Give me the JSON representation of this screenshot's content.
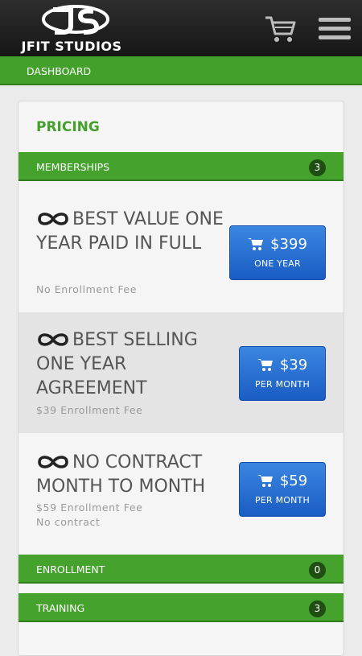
{
  "brand": {
    "name": "JFIT STUDIOS"
  },
  "header": {
    "cart_icon": "cart-icon",
    "menu_icon": "hamburger-menu-icon"
  },
  "breadcrumb": {
    "label": "DASHBOARD"
  },
  "pricing": {
    "title": "PRICING",
    "sections": [
      {
        "label": "MEMBERSHIPS",
        "count": "3"
      },
      {
        "label": "ENROLLMENT",
        "count": "0"
      },
      {
        "label": "TRAINING",
        "count": "3"
      }
    ],
    "plans": [
      {
        "name": "BEST VALUE ONE YEAR PAID IN FULL",
        "notes": [
          "No Enrollment Fee"
        ],
        "price": "$399",
        "period": "ONE YEAR"
      },
      {
        "name": "BEST SELLING ONE YEAR AGREEMENT",
        "notes": [
          "$39 Enrollment Fee"
        ],
        "price": "$39",
        "period": "PER MONTH"
      },
      {
        "name": "NO CONTRACT MONTH TO MONTH",
        "notes": [
          "$59 Enrollment Fee",
          "No contract"
        ],
        "price": "$59",
        "period": "PER MONTH"
      }
    ]
  },
  "colors": {
    "accent_green": "#43a02a",
    "badge_green": "#1f4d12",
    "button_blue": "#1a5cc4",
    "header_dark": "#1e1e1e"
  }
}
